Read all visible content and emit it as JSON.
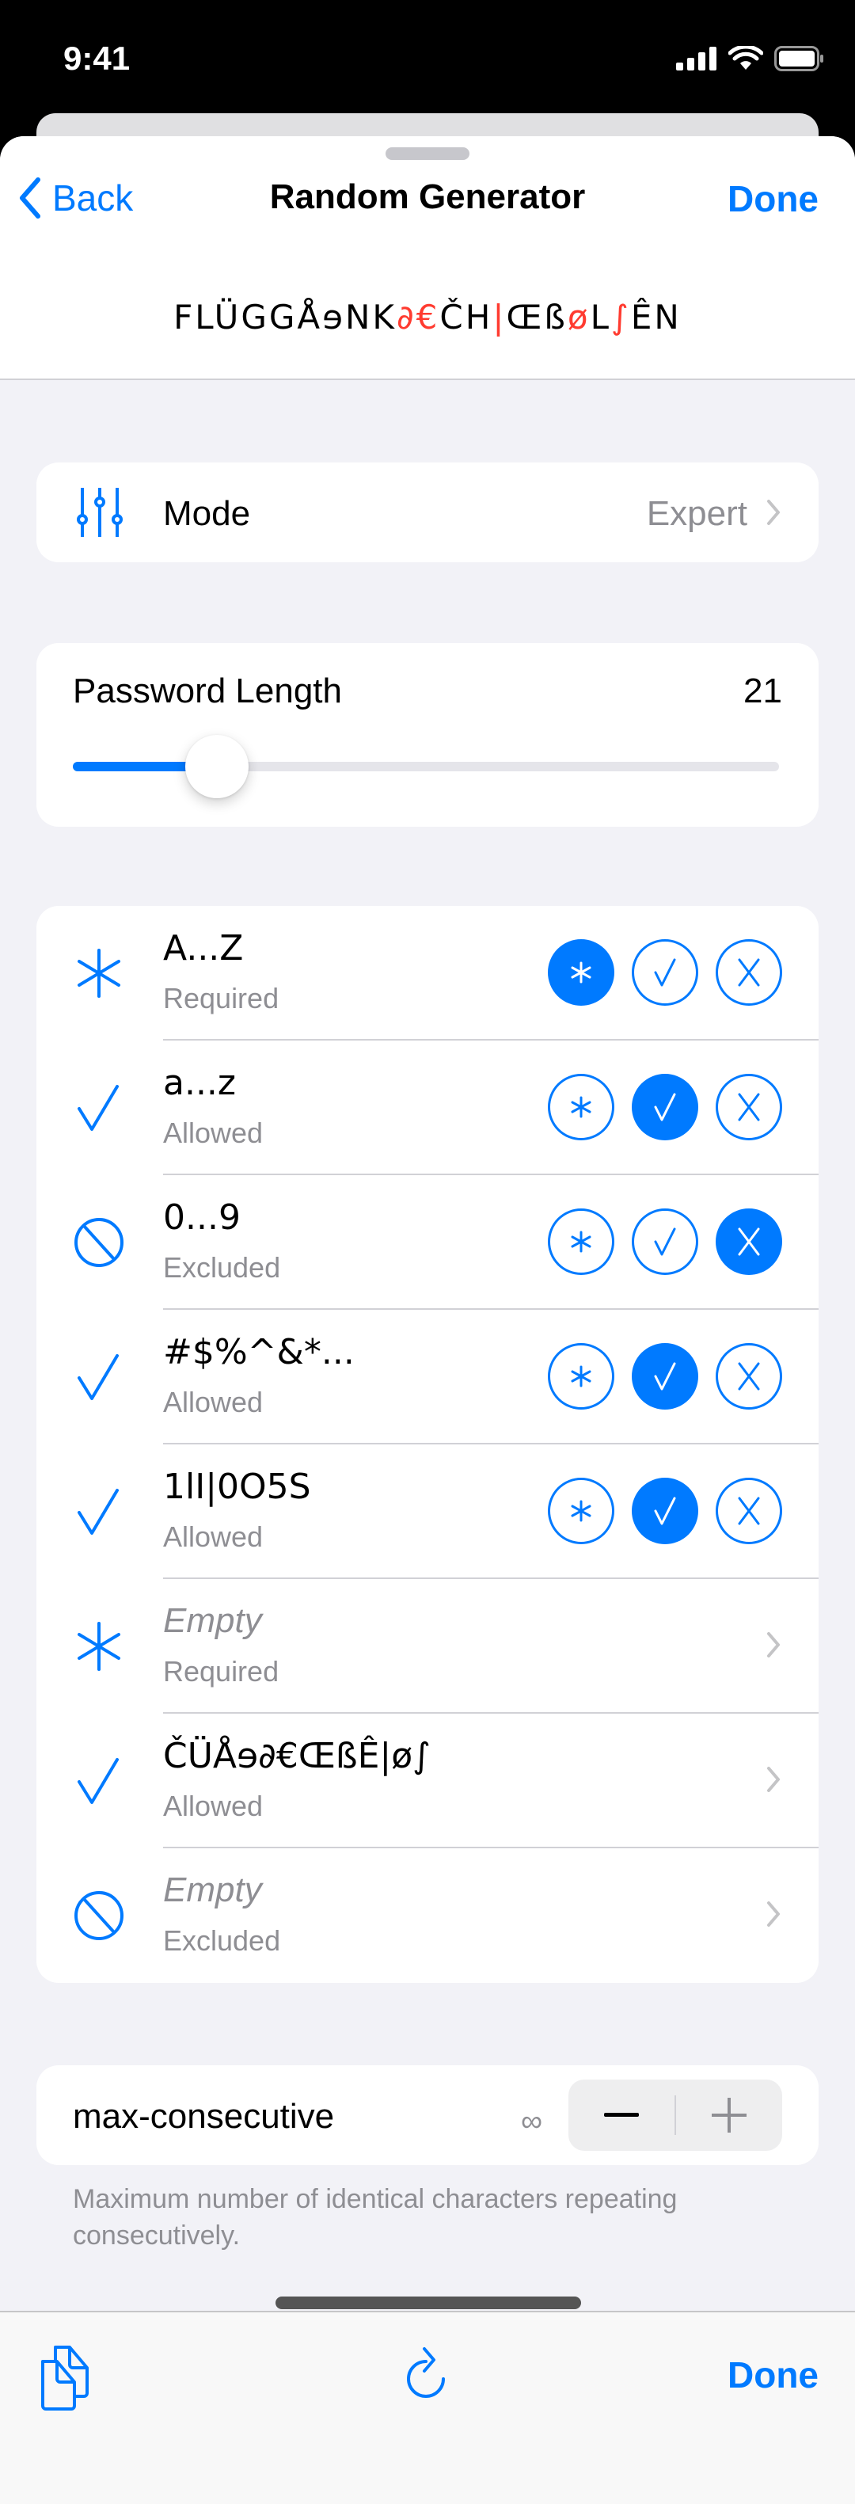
{
  "status_bar": {
    "time": "9:41"
  },
  "nav": {
    "back_label": "Back",
    "title": "Random Generator",
    "done_label": "Done"
  },
  "password": {
    "segments": [
      {
        "text": "FLÜGGÅɘNK",
        "red": false
      },
      {
        "text": "∂€",
        "red": true
      },
      {
        "text": "ČH",
        "red": false
      },
      {
        "text": "|",
        "red": true
      },
      {
        "text": "Œß",
        "red": false
      },
      {
        "text": "ø",
        "red": true
      },
      {
        "text": "L",
        "red": false
      },
      {
        "text": "∫",
        "red": true
      },
      {
        "text": "ÊN",
        "red": false
      }
    ]
  },
  "mode": {
    "label": "Mode",
    "value": "Expert"
  },
  "length": {
    "label": "Password Length",
    "value": "21",
    "slider_fraction": 0.17
  },
  "char_sets": [
    {
      "title": "A...Z",
      "status": "Required",
      "state": "required",
      "empty": false,
      "editable_toggle": true
    },
    {
      "title": "a...z",
      "status": "Allowed",
      "state": "allowed",
      "empty": false,
      "editable_toggle": true
    },
    {
      "title": "0...9",
      "status": "Excluded",
      "state": "excluded",
      "empty": false,
      "editable_toggle": true
    },
    {
      "title": "#$%^&*...",
      "status": "Allowed",
      "state": "allowed",
      "empty": false,
      "editable_toggle": true
    },
    {
      "title": "1lI|0O5S",
      "status": "Allowed",
      "state": "allowed",
      "empty": false,
      "editable_toggle": true
    },
    {
      "title": "Empty",
      "status": "Required",
      "state": "required",
      "empty": true,
      "editable_toggle": false
    },
    {
      "title": "ČÜÅɘ∂€ŒßÊ|ø∫",
      "status": "Allowed",
      "state": "allowed",
      "empty": false,
      "editable_toggle": false
    },
    {
      "title": "Empty",
      "status": "Excluded",
      "state": "excluded",
      "empty": true,
      "editable_toggle": false
    }
  ],
  "max_consecutive": {
    "label": "max-consecutive",
    "value": "∞",
    "decrement_label": "−",
    "increment_label": "+",
    "footer": "Maximum number of identical characters repeating consecutively."
  },
  "toolbar": {
    "done_label": "Done"
  },
  "colors": {
    "accent": "#007aff",
    "highlight": "#ff3b30",
    "secondary_text": "#8e8e93"
  }
}
